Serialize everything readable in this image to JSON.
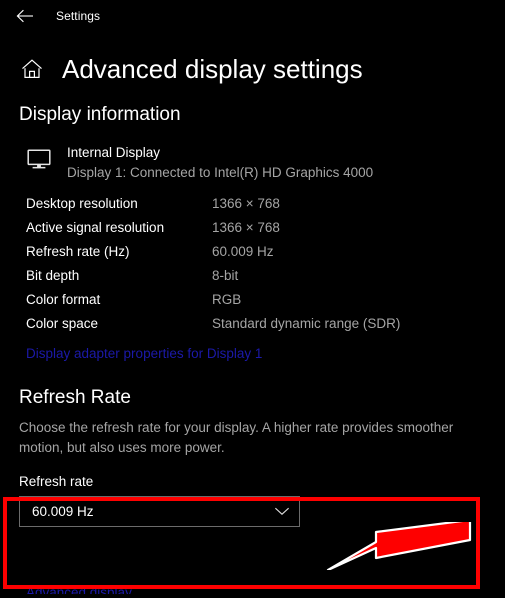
{
  "window": {
    "app_title": "Settings",
    "back_icon": "back-arrow-icon"
  },
  "header": {
    "home_icon": "home-icon",
    "page_title": "Advanced display settings"
  },
  "display_information": {
    "section_title": "Display information",
    "monitor_icon": "monitor-icon",
    "display_name": "Internal Display",
    "display_subtitle": "Display 1: Connected to Intel(R) HD Graphics 4000",
    "specs": [
      {
        "label": "Desktop resolution",
        "value": "1366 × 768"
      },
      {
        "label": "Active signal resolution",
        "value": "1366 × 768"
      },
      {
        "label": "Refresh rate (Hz)",
        "value": "60.009 Hz"
      },
      {
        "label": "Bit depth",
        "value": "8-bit"
      },
      {
        "label": "Color format",
        "value": "RGB"
      },
      {
        "label": "Color space",
        "value": "Standard dynamic range (SDR)"
      }
    ],
    "adapter_link": "Display adapter properties for Display 1"
  },
  "refresh_rate": {
    "section_title": "Refresh Rate",
    "description": "Choose the refresh rate for your display. A higher rate provides smoother motion, but also uses more power.",
    "field_label": "Refresh rate",
    "selected_value": "60.009 Hz",
    "chevron_icon": "chevron-down-icon"
  },
  "footer": {
    "partial_link": "Advanced display"
  },
  "annotations": {
    "highlight_color": "#fe0000",
    "arrow_outline_color": "#ffffff",
    "box_label": "refresh-rate-highlight",
    "arrow_label": "pointer-arrow"
  },
  "colors": {
    "background": "#000000",
    "primary_text": "#ffffff",
    "secondary_text": "#a5a5a5",
    "link": "#1b19a8",
    "control_border": "#6b6b6b"
  }
}
